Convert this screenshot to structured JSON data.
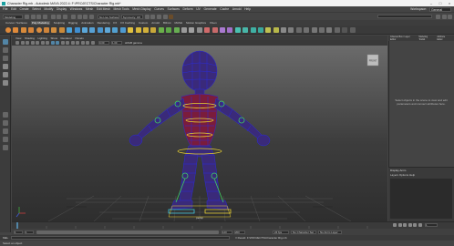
{
  "window": {
    "title": "Character Rig.mb - Autodesk MAYA 2022.4: F:\\PROJECTS\\Character Rig.mb*",
    "minimize_icon": "minimize-icon",
    "maximize_icon": "maximize-icon",
    "close_icon": "close-icon"
  },
  "menu": [
    "File",
    "Edit",
    "Create",
    "Select",
    "Modify",
    "Display",
    "Windows",
    "Mesh",
    "Edit Mesh",
    "Mesh Tools",
    "Mesh Display",
    "Curves",
    "Surfaces",
    "Deform",
    "UV",
    "Generate",
    "Cache",
    "Arnold",
    "Help"
  ],
  "status_line": {
    "menuset": "Modeling",
    "live_surface": "No Live Surface",
    "symmetry": "Symmetry: Off",
    "workspace_label": "Workspace:",
    "workspace_value": "General"
  },
  "shelf_tabs": [
    "Curves / Surfaces",
    "Poly Modeling",
    "Sculpting",
    "Rigging",
    "Animation",
    "Rendering",
    "FX",
    "FX Caching",
    "Custom",
    "Arnold",
    "Bifrost",
    "MASH",
    "Motion Graphics",
    "XGen"
  ],
  "shelf_active_tab": "Poly Modeling",
  "viewport": {
    "menu": [
      "View",
      "Shading",
      "Lighting",
      "Show",
      "Renderer",
      "Panels"
    ],
    "camera_label": "persp",
    "srgb_label": "sRGB gamma",
    "exposure_value": "0.00",
    "gamma_value": "1.00",
    "viewcube_label": "FRONT"
  },
  "right_panel": {
    "tabs": [
      "Channel Box / Layer Editor",
      "Modeling Toolkit",
      "Attribute Editor"
    ],
    "empty_message": "Select objects in the scene to view and edit parameters and connect attributes here.",
    "layer_header": "Display  Anim",
    "layer_sub": "Layers  Options  Help"
  },
  "timeline": {
    "start": "1",
    "end": "120",
    "current": "1",
    "range_start": "1",
    "range_end": "120",
    "range_max": "200",
    "fps": "24 fps",
    "no_character_set": "No Character Set",
    "no_anim_layer": "No Anim Layer"
  },
  "command_line": {
    "language": "MEL",
    "result": "// Result: F:\\PROJECTS\\Character Rig.mb"
  },
  "help_line": "Select an object",
  "colors": {
    "accent": "#5285a6",
    "mesh_wire": "#2a2ad8",
    "mesh_fill": "#8a1c3c",
    "controls_green": "#40d060",
    "controls_yellow": "#e8d030",
    "controls_cyan": "#40c8e0"
  }
}
